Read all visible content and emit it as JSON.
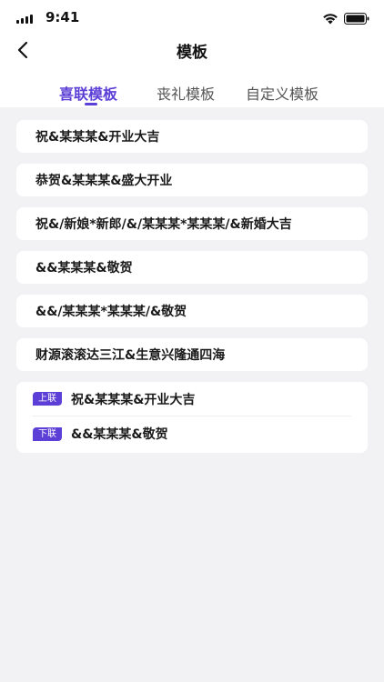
{
  "status_bar": {
    "time": "9:41"
  },
  "nav": {
    "title": "模板"
  },
  "tabs": [
    {
      "label": "喜联模板",
      "active": true
    },
    {
      "label": "丧礼模板",
      "active": false
    },
    {
      "label": "自定义模板",
      "active": false
    }
  ],
  "templates": [
    "祝&某某某&开业大吉",
    "恭贺&某某某&盛大开业",
    "祝&/新娘*新郎/&/某某某*某某某/&新婚大吉",
    "&&某某某&敬贺",
    "&&/某某某*某某某/&敬贺",
    "财源滚滚达三江&生意兴隆通四海"
  ],
  "couplet": {
    "upper": {
      "badge": "上联",
      "text": "祝&某某某&开业大吉"
    },
    "lower": {
      "badge": "下联",
      "text": "&&某某某&敬贺"
    }
  },
  "colors": {
    "accent": "#5b3fd6",
    "background": "#f2f2f4"
  }
}
